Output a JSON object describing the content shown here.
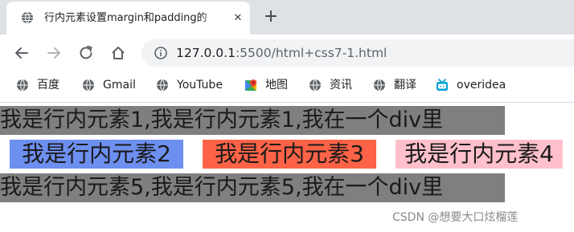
{
  "tab": {
    "title": "行内元素设置margin和padding的",
    "close_glyph": "✕",
    "new_tab_glyph": "+"
  },
  "toolbar": {
    "url_host": "127.0.0.1",
    "url_rest": ":5500/html+css7-1.html"
  },
  "bookmarks": [
    {
      "label": "百度",
      "icon": "globe-icon"
    },
    {
      "label": "Gmail",
      "icon": "globe-icon"
    },
    {
      "label": "YouTube",
      "icon": "globe-icon"
    },
    {
      "label": "地图",
      "icon": "maps-icon"
    },
    {
      "label": "资讯",
      "icon": "globe-icon"
    },
    {
      "label": "翻译",
      "icon": "globe-icon"
    },
    {
      "label": "overidea",
      "icon": "tv-icon"
    }
  ],
  "content": {
    "line1": "我是行内元素1,我是行内元素1,我在一个div里",
    "span2": "我是行内元素2",
    "span3": "我是行内元素3",
    "span4": "我是行内元素4",
    "line5": "我是行内元素5,我是行内元素5,我在一个div里",
    "colors": {
      "gray": "#7f7f7f",
      "span2": "#6d8ff0",
      "span3": "#ff6347",
      "span4": "#ffc0cb"
    }
  },
  "watermark": "CSDN @想要大口炫榴莲"
}
